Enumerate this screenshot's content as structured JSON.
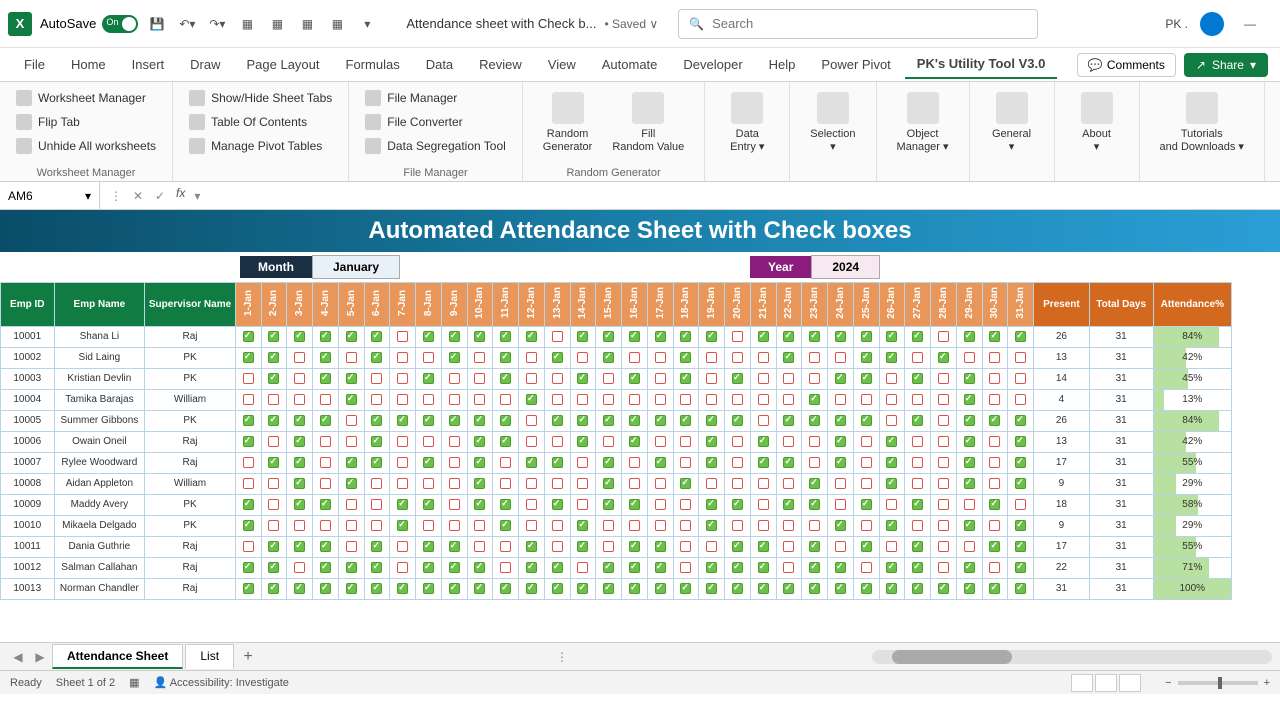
{
  "titlebar": {
    "autosave": "AutoSave",
    "autosave_state": "On",
    "doc": "Attendance sheet with Check b...",
    "saved": "• Saved ∨",
    "search_placeholder": "Search",
    "user": "PK .",
    "minimize": "—"
  },
  "tabs": {
    "items": [
      "File",
      "Home",
      "Insert",
      "Draw",
      "Page Layout",
      "Formulas",
      "Data",
      "Review",
      "View",
      "Automate",
      "Developer",
      "Help",
      "Power Pivot",
      "PK's Utility Tool V3.0"
    ],
    "active": 13,
    "comments": "Comments",
    "share": "Share"
  },
  "ribbon": {
    "groups": [
      {
        "label": "Worksheet Manager",
        "items": [
          "Worksheet Manager",
          "Flip Tab",
          "Unhide All worksheets"
        ]
      },
      {
        "label": "",
        "items": [
          "Show/Hide Sheet Tabs",
          "Table Of Contents",
          "Manage Pivot Tables"
        ]
      },
      {
        "label": "File Manager",
        "items": [
          "File Manager",
          "File Converter",
          "Data Segregation Tool"
        ]
      },
      {
        "label": "Random Generator",
        "big": [
          "Random Generator",
          "Fill Random Value"
        ]
      },
      {
        "label": "",
        "big": [
          "Data Entry ▾"
        ]
      },
      {
        "label": "",
        "big": [
          "Selection ▾"
        ]
      },
      {
        "label": "",
        "big": [
          "Object Manager ▾"
        ]
      },
      {
        "label": "",
        "big": [
          "General ▾"
        ]
      },
      {
        "label": "",
        "big": [
          "About ▾"
        ]
      },
      {
        "label": "",
        "big": [
          "Tutorials and Downloads ▾"
        ]
      }
    ]
  },
  "formula": {
    "cell": "AM6",
    "fx": "fx"
  },
  "banner": "Automated Attendance Sheet with Check boxes",
  "controls": {
    "month_lbl": "Month",
    "month_val": "January",
    "year_lbl": "Year",
    "year_val": "2024"
  },
  "headers": {
    "emp_id": "Emp ID",
    "emp_name": "Emp Name",
    "sup": "Supervisor Name",
    "present": "Present",
    "total": "Total Days",
    "att": "Attendance%"
  },
  "days": [
    "1-Jan",
    "2-Jan",
    "3-Jan",
    "4-Jan",
    "5-Jan",
    "6-Jan",
    "7-Jan",
    "8-Jan",
    "9-Jan",
    "10-Jan",
    "11-Jan",
    "12-Jan",
    "13-Jan",
    "14-Jan",
    "15-Jan",
    "16-Jan",
    "17-Jan",
    "18-Jan",
    "19-Jan",
    "20-Jan",
    "21-Jan",
    "22-Jan",
    "23-Jan",
    "24-Jan",
    "25-Jan",
    "26-Jan",
    "27-Jan",
    "28-Jan",
    "29-Jan",
    "30-Jan",
    "31-Jan"
  ],
  "rows": [
    {
      "id": "10001",
      "name": "Shana Li",
      "sup": "Raj",
      "present": 26,
      "total": 31,
      "att": "84%",
      "pct": 84,
      "chk": [
        1,
        1,
        1,
        1,
        1,
        1,
        0,
        1,
        1,
        1,
        1,
        1,
        0,
        1,
        1,
        1,
        1,
        1,
        1,
        0,
        1,
        1,
        1,
        1,
        1,
        1,
        1,
        0,
        1,
        1,
        1
      ]
    },
    {
      "id": "10002",
      "name": "Sid Laing",
      "sup": "PK",
      "present": 13,
      "total": 31,
      "att": "42%",
      "pct": 42,
      "chk": [
        1,
        1,
        0,
        1,
        0,
        1,
        0,
        0,
        1,
        0,
        1,
        0,
        1,
        0,
        1,
        0,
        0,
        1,
        0,
        0,
        0,
        1,
        0,
        0,
        1,
        1,
        0,
        1,
        0,
        0,
        0
      ]
    },
    {
      "id": "10003",
      "name": "Kristian Devlin",
      "sup": "PK",
      "present": 14,
      "total": 31,
      "att": "45%",
      "pct": 45,
      "chk": [
        0,
        1,
        0,
        1,
        1,
        0,
        0,
        1,
        0,
        0,
        1,
        0,
        0,
        1,
        0,
        1,
        0,
        1,
        0,
        1,
        0,
        0,
        0,
        1,
        1,
        0,
        1,
        0,
        1,
        0,
        0
      ]
    },
    {
      "id": "10004",
      "name": "Tamika Barajas",
      "sup": "William",
      "present": 4,
      "total": 31,
      "att": "13%",
      "pct": 13,
      "chk": [
        0,
        0,
        0,
        0,
        1,
        0,
        0,
        0,
        0,
        0,
        0,
        1,
        0,
        0,
        0,
        0,
        0,
        0,
        0,
        0,
        0,
        0,
        1,
        0,
        0,
        0,
        0,
        0,
        1,
        0,
        0
      ]
    },
    {
      "id": "10005",
      "name": "Summer Gibbons",
      "sup": "PK",
      "present": 26,
      "total": 31,
      "att": "84%",
      "pct": 84,
      "chk": [
        1,
        1,
        1,
        1,
        0,
        1,
        1,
        1,
        1,
        1,
        1,
        0,
        1,
        1,
        1,
        1,
        1,
        1,
        1,
        1,
        0,
        1,
        1,
        1,
        1,
        0,
        1,
        0,
        1,
        1,
        1
      ]
    },
    {
      "id": "10006",
      "name": "Owain Oneil",
      "sup": "Raj",
      "present": 13,
      "total": 31,
      "att": "42%",
      "pct": 42,
      "chk": [
        1,
        0,
        1,
        0,
        0,
        1,
        0,
        0,
        0,
        1,
        1,
        0,
        0,
        1,
        0,
        1,
        0,
        0,
        1,
        0,
        1,
        0,
        0,
        1,
        0,
        1,
        0,
        0,
        1,
        0,
        1
      ]
    },
    {
      "id": "10007",
      "name": "Rylee Woodward",
      "sup": "Raj",
      "present": 17,
      "total": 31,
      "att": "55%",
      "pct": 55,
      "chk": [
        0,
        1,
        1,
        0,
        1,
        1,
        0,
        1,
        0,
        1,
        0,
        1,
        1,
        0,
        1,
        0,
        1,
        0,
        1,
        0,
        1,
        1,
        0,
        1,
        0,
        1,
        0,
        0,
        1,
        0,
        1
      ]
    },
    {
      "id": "10008",
      "name": "Aidan Appleton",
      "sup": "William",
      "present": 9,
      "total": 31,
      "att": "29%",
      "pct": 29,
      "chk": [
        0,
        0,
        1,
        0,
        1,
        0,
        0,
        0,
        0,
        1,
        0,
        0,
        0,
        0,
        1,
        0,
        0,
        1,
        0,
        0,
        0,
        0,
        1,
        0,
        0,
        1,
        0,
        0,
        1,
        0,
        1
      ]
    },
    {
      "id": "10009",
      "name": "Maddy Avery",
      "sup": "PK",
      "present": 18,
      "total": 31,
      "att": "58%",
      "pct": 58,
      "chk": [
        1,
        0,
        1,
        1,
        0,
        0,
        1,
        1,
        0,
        1,
        1,
        0,
        1,
        0,
        1,
        1,
        0,
        0,
        1,
        1,
        0,
        1,
        1,
        0,
        1,
        0,
        1,
        0,
        0,
        1,
        0
      ]
    },
    {
      "id": "10010",
      "name": "Mikaela Delgado",
      "sup": "PK",
      "present": 9,
      "total": 31,
      "att": "29%",
      "pct": 29,
      "chk": [
        1,
        0,
        0,
        0,
        0,
        0,
        1,
        0,
        0,
        0,
        1,
        0,
        0,
        1,
        0,
        0,
        0,
        0,
        1,
        0,
        0,
        0,
        0,
        1,
        0,
        1,
        0,
        0,
        1,
        0,
        1
      ]
    },
    {
      "id": "10011",
      "name": "Dania Guthrie",
      "sup": "Raj",
      "present": 17,
      "total": 31,
      "att": "55%",
      "pct": 55,
      "chk": [
        0,
        1,
        1,
        1,
        0,
        1,
        0,
        1,
        1,
        0,
        0,
        1,
        0,
        1,
        0,
        1,
        1,
        0,
        0,
        1,
        1,
        0,
        1,
        0,
        1,
        0,
        1,
        0,
        0,
        1,
        1
      ]
    },
    {
      "id": "10012",
      "name": "Salman Callahan",
      "sup": "Raj",
      "present": 22,
      "total": 31,
      "att": "71%",
      "pct": 71,
      "chk": [
        1,
        1,
        0,
        1,
        1,
        1,
        0,
        1,
        1,
        1,
        0,
        1,
        1,
        0,
        1,
        1,
        1,
        0,
        1,
        1,
        1,
        0,
        1,
        1,
        0,
        1,
        1,
        0,
        1,
        0,
        1
      ]
    },
    {
      "id": "10013",
      "name": "Norman Chandler",
      "sup": "Raj",
      "present": 31,
      "total": 31,
      "att": "100%",
      "pct": 100,
      "chk": [
        1,
        1,
        1,
        1,
        1,
        1,
        1,
        1,
        1,
        1,
        1,
        1,
        1,
        1,
        1,
        1,
        1,
        1,
        1,
        1,
        1,
        1,
        1,
        1,
        1,
        1,
        1,
        1,
        1,
        1,
        1
      ]
    }
  ],
  "sheet_tabs": {
    "tabs": [
      "Attendance Sheet",
      "List"
    ],
    "active": 0,
    "add": "+"
  },
  "statusbar": {
    "ready": "Ready",
    "sheet": "Sheet 1 of 2",
    "access": "Accessibility: Investigate",
    "zoom_minus": "−",
    "zoom_plus": "+"
  }
}
